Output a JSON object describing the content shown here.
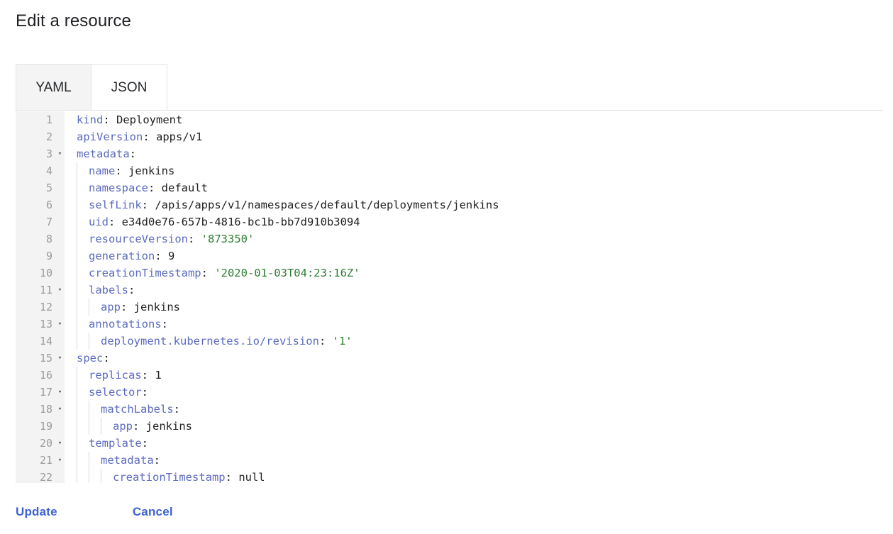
{
  "page": {
    "title": "Edit a resource"
  },
  "tabs": [
    {
      "id": "yaml",
      "label": "YAML",
      "selected": true
    },
    {
      "id": "json",
      "label": "JSON",
      "selected": false
    }
  ],
  "editor": {
    "language": "yaml",
    "first_visible_line": 1,
    "last_visible_line": 22,
    "colors": {
      "key": "#5c6bc0",
      "string": "#2e7d32",
      "value": "#222222",
      "gutter_bg": "#f3f3f3",
      "gutter_fg": "#9a9a9a"
    },
    "lines": [
      {
        "n": 1,
        "fold": false,
        "indent": 0,
        "key": "kind",
        "sep": ": ",
        "value": "Deployment",
        "value_type": "plain"
      },
      {
        "n": 2,
        "fold": false,
        "indent": 0,
        "key": "apiVersion",
        "sep": ": ",
        "value": "apps/v1",
        "value_type": "plain"
      },
      {
        "n": 3,
        "fold": true,
        "indent": 0,
        "key": "metadata",
        "sep": ":",
        "value": "",
        "value_type": "none"
      },
      {
        "n": 4,
        "fold": false,
        "indent": 1,
        "key": "name",
        "sep": ": ",
        "value": "jenkins",
        "value_type": "plain"
      },
      {
        "n": 5,
        "fold": false,
        "indent": 1,
        "key": "namespace",
        "sep": ": ",
        "value": "default",
        "value_type": "plain"
      },
      {
        "n": 6,
        "fold": false,
        "indent": 1,
        "key": "selfLink",
        "sep": ": ",
        "value": "/apis/apps/v1/namespaces/default/deployments/jenkins",
        "value_type": "plain"
      },
      {
        "n": 7,
        "fold": false,
        "indent": 1,
        "key": "uid",
        "sep": ": ",
        "value": "e34d0e76-657b-4816-bc1b-bb7d910b3094",
        "value_type": "plain"
      },
      {
        "n": 8,
        "fold": false,
        "indent": 1,
        "key": "resourceVersion",
        "sep": ": ",
        "value": "'873350'",
        "value_type": "string"
      },
      {
        "n": 9,
        "fold": false,
        "indent": 1,
        "key": "generation",
        "sep": ": ",
        "value": "9",
        "value_type": "plain"
      },
      {
        "n": 10,
        "fold": false,
        "indent": 1,
        "key": "creationTimestamp",
        "sep": ": ",
        "value": "'2020-01-03T04:23:16Z'",
        "value_type": "string"
      },
      {
        "n": 11,
        "fold": true,
        "indent": 1,
        "key": "labels",
        "sep": ":",
        "value": "",
        "value_type": "none"
      },
      {
        "n": 12,
        "fold": false,
        "indent": 2,
        "key": "app",
        "sep": ": ",
        "value": "jenkins",
        "value_type": "plain"
      },
      {
        "n": 13,
        "fold": true,
        "indent": 1,
        "key": "annotations",
        "sep": ":",
        "value": "",
        "value_type": "none"
      },
      {
        "n": 14,
        "fold": false,
        "indent": 2,
        "key": "deployment.kubernetes.io/revision",
        "sep": ": ",
        "value": "'1'",
        "value_type": "string"
      },
      {
        "n": 15,
        "fold": true,
        "indent": 0,
        "key": "spec",
        "sep": ":",
        "value": "",
        "value_type": "none"
      },
      {
        "n": 16,
        "fold": false,
        "indent": 1,
        "key": "replicas",
        "sep": ": ",
        "value": "1",
        "value_type": "plain"
      },
      {
        "n": 17,
        "fold": true,
        "indent": 1,
        "key": "selector",
        "sep": ":",
        "value": "",
        "value_type": "none"
      },
      {
        "n": 18,
        "fold": true,
        "indent": 2,
        "key": "matchLabels",
        "sep": ":",
        "value": "",
        "value_type": "none"
      },
      {
        "n": 19,
        "fold": false,
        "indent": 3,
        "key": "app",
        "sep": ": ",
        "value": "jenkins",
        "value_type": "plain"
      },
      {
        "n": 20,
        "fold": true,
        "indent": 1,
        "key": "template",
        "sep": ":",
        "value": "",
        "value_type": "none"
      },
      {
        "n": 21,
        "fold": true,
        "indent": 2,
        "key": "metadata",
        "sep": ":",
        "value": "",
        "value_type": "none"
      },
      {
        "n": 22,
        "fold": false,
        "indent": 3,
        "key": "creationTimestamp",
        "sep": ": ",
        "value": "null",
        "value_type": "plain"
      }
    ]
  },
  "footer": {
    "update_label": "Update",
    "cancel_label": "Cancel",
    "link_color": "#3f63d4"
  }
}
